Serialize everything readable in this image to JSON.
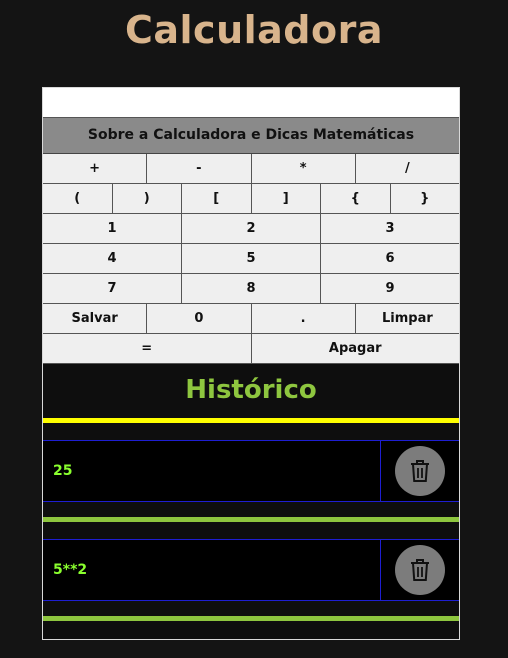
{
  "app": {
    "title": "Calculadora"
  },
  "display": {
    "value": ""
  },
  "about": {
    "label": "Sobre a Calculadora e Dicas Matemáticas"
  },
  "keys": {
    "row1": [
      "+",
      "-",
      "*",
      "/"
    ],
    "row2": [
      "(",
      ")",
      "[",
      "]",
      "{",
      "}"
    ],
    "row3": [
      "1",
      "2",
      "3"
    ],
    "row4": [
      "4",
      "5",
      "6"
    ],
    "row5": [
      "7",
      "8",
      "9"
    ],
    "row6": [
      "Salvar",
      "0",
      ".",
      "Limpar"
    ],
    "row7": [
      "=",
      "Apagar"
    ]
  },
  "history": {
    "title": "Histórico",
    "items": [
      {
        "expression": "25",
        "icon": "trash-icon"
      },
      {
        "expression": "5**2",
        "icon": "trash-icon"
      }
    ]
  },
  "colors": {
    "title": "#d8b48c",
    "history_title": "#8ec63f",
    "history_text": "#8aff2e",
    "yellow_divider": "#ffff00",
    "green_divider": "#8ec63f",
    "row_border": "#1e1ed2"
  }
}
